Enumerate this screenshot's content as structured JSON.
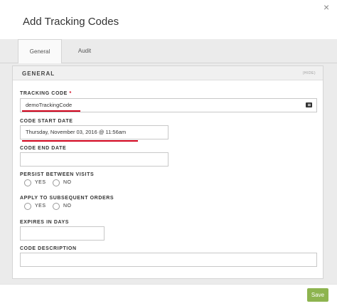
{
  "dialog": {
    "title": "Add Tracking Codes",
    "close_glyph": "×"
  },
  "tabs": [
    {
      "label": "General"
    },
    {
      "label": "Audit"
    }
  ],
  "section": {
    "title": "GENERAL",
    "hide_label": "(HIDE)"
  },
  "fields": {
    "tracking_code": {
      "label": "TRACKING CODE",
      "required_mark": "*",
      "value": "demoTrackingCode",
      "icon": "id-card-icon"
    },
    "code_start_date": {
      "label": "CODE START DATE",
      "value": "Thursday, November 03, 2016 @ 11:56am"
    },
    "code_end_date": {
      "label": "CODE END DATE",
      "value": ""
    },
    "persist_between_visits": {
      "label": "PERSIST BETWEEN VISITS",
      "options": [
        "YES",
        "NO"
      ]
    },
    "apply_to_subsequent_orders": {
      "label": "APPLY TO SUBSEQUENT ORDERS",
      "options": [
        "YES",
        "NO"
      ]
    },
    "expires_in_days": {
      "label": "EXPIRES IN DAYS",
      "value": ""
    },
    "code_description": {
      "label": "CODE DESCRIPTION",
      "value": ""
    }
  },
  "footer": {
    "save_label": "Save"
  },
  "colors": {
    "accent_green": "#8db44f",
    "required_red": "#d0021b",
    "annotation_red": "#d0021b"
  }
}
